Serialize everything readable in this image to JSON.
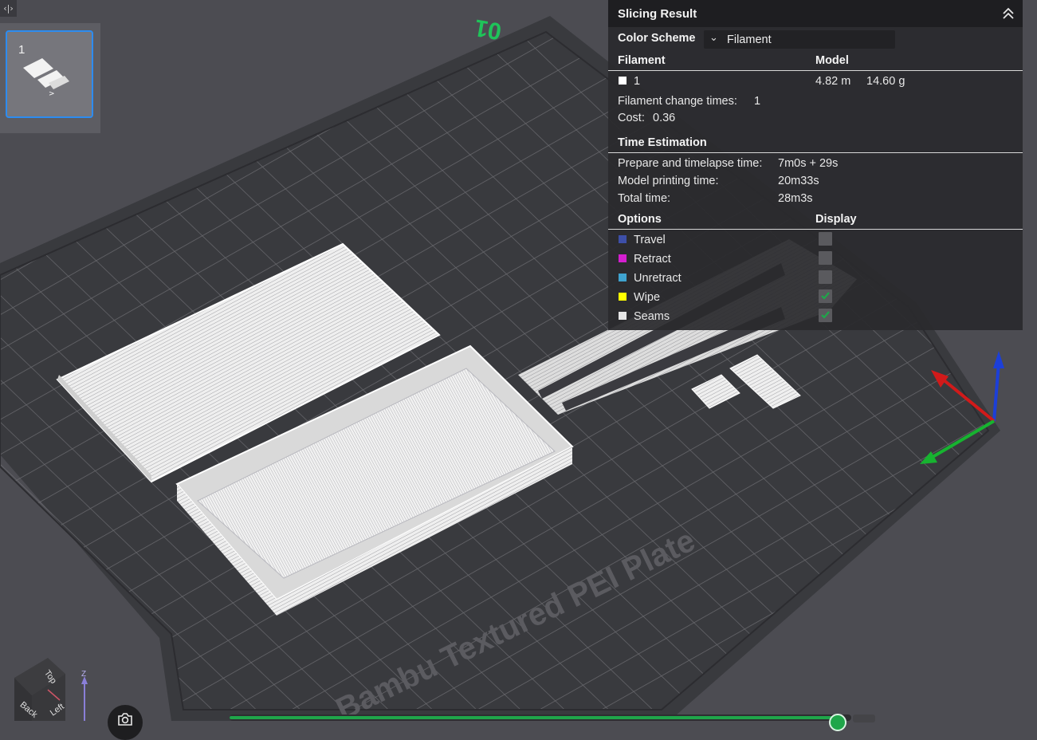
{
  "panel": {
    "title": "Slicing Result",
    "color_scheme_label": "Color Scheme",
    "color_scheme_value": "Filament",
    "filament_header": "Filament",
    "model_header": "Model",
    "filament_id": "1",
    "filament_length": "4.82 m",
    "filament_weight": "14.60 g",
    "change_times_label": "Filament change times:",
    "change_times_value": "1",
    "cost_label": "Cost:",
    "cost_value": "0.36",
    "time_header": "Time Estimation",
    "prepare_label": "Prepare and timelapse time:",
    "prepare_value": "7m0s + 29s",
    "model_time_label": "Model printing time:",
    "model_time_value": "20m33s",
    "total_label": "Total time:",
    "total_value": "28m3s",
    "options_header": "Options",
    "display_header": "Display",
    "options": [
      {
        "label": "Travel",
        "color": "#3d4fa8",
        "checked": false
      },
      {
        "label": "Retract",
        "color": "#d41fcf",
        "checked": false
      },
      {
        "label": "Unretract",
        "color": "#3fa3cf",
        "checked": false
      },
      {
        "label": "Wipe",
        "color": "#ffff00",
        "checked": true
      },
      {
        "label": "Seams",
        "color": "#e6e6e6",
        "checked": true
      }
    ]
  },
  "plate_list": {
    "plate_number": "1",
    "active": true
  },
  "scene": {
    "plate_label": "Bambu Textured PEI Plate",
    "plate_index": "01",
    "view_cube_faces": [
      "Top",
      "Back",
      "Left"
    ],
    "axis_label": "Z"
  },
  "colors": {
    "accent": "#2d8cf0",
    "slider": "#1fa64a"
  },
  "icons": {
    "collapse_panel": "double-chevron-up-icon",
    "toggle": "code-brackets-icon",
    "camera": "screenshot-camera-icon",
    "dropdown": "chevron-down-icon",
    "check": "check-icon"
  },
  "layer_slider": {
    "position": 0.98
  }
}
